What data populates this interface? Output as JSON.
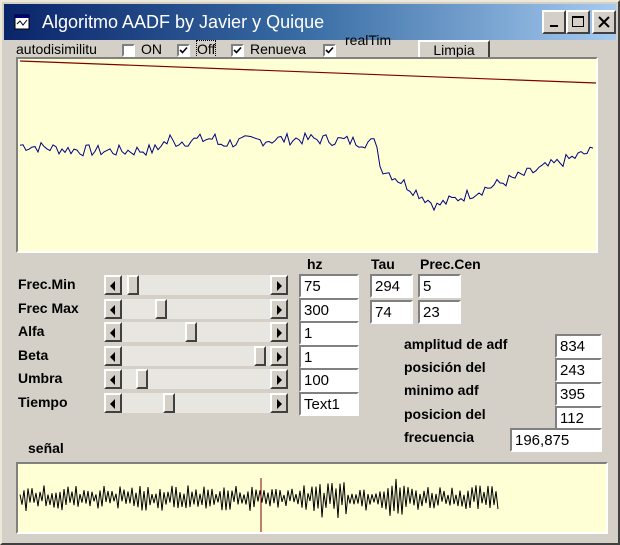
{
  "window": {
    "title": "Algoritmo AADF by Javier y Quique"
  },
  "top_bar": {
    "autodisimilitud_label": "autodisimilitu",
    "on_label": "ON",
    "off_label": "Off",
    "renueva_label": "Renueva",
    "realtime_label": "realTim",
    "limpia_label": "Limpia",
    "autodisimilitud_checked": false,
    "on_checked": true,
    "off_checked": true,
    "renueva_checked": true
  },
  "sliders": [
    {
      "label": "Frec.Min",
      "position": 0.04
    },
    {
      "label": "Frec Max",
      "position": 0.24
    },
    {
      "label": "Alfa",
      "position": 0.46
    },
    {
      "label": "Beta",
      "position": 0.97
    },
    {
      "label": "Umbra",
      "position": 0.1
    },
    {
      "label": "Tiempo",
      "position": 0.3
    }
  ],
  "hz": {
    "header": "hz",
    "values": [
      "75",
      "300",
      "1",
      "1",
      "100",
      "Text1"
    ]
  },
  "tau": {
    "header": "Tau",
    "values": [
      "294",
      "74"
    ]
  },
  "prec": {
    "header": "Prec.Cen",
    "values": [
      "5",
      "23"
    ]
  },
  "stats": [
    {
      "label": "amplitud de adf",
      "value": "834"
    },
    {
      "label": "posición del",
      "value": "243"
    },
    {
      "label": "minimo adf",
      "value": "395"
    },
    {
      "label": "posicion del",
      "value": "112"
    },
    {
      "label": "frecuencia",
      "value": "196,875"
    }
  ],
  "signal": {
    "label": "señal"
  },
  "colors": {
    "plot_background": "#ffffd6",
    "adf_curve": "#000080",
    "reference_line": "#800000",
    "signal_wave": "#000000",
    "signal_marker": "#800000",
    "titlebar_start": "#0a246a",
    "titlebar_end": "#a6caf0"
  },
  "icons": {
    "app": "app-window-icon",
    "minimize": "minimize-icon",
    "maximize": "maximize-icon",
    "close": "close-icon",
    "check": "checkmark-icon",
    "arrow_left": "arrow-left-icon",
    "arrow_right": "arrow-right-icon"
  }
}
